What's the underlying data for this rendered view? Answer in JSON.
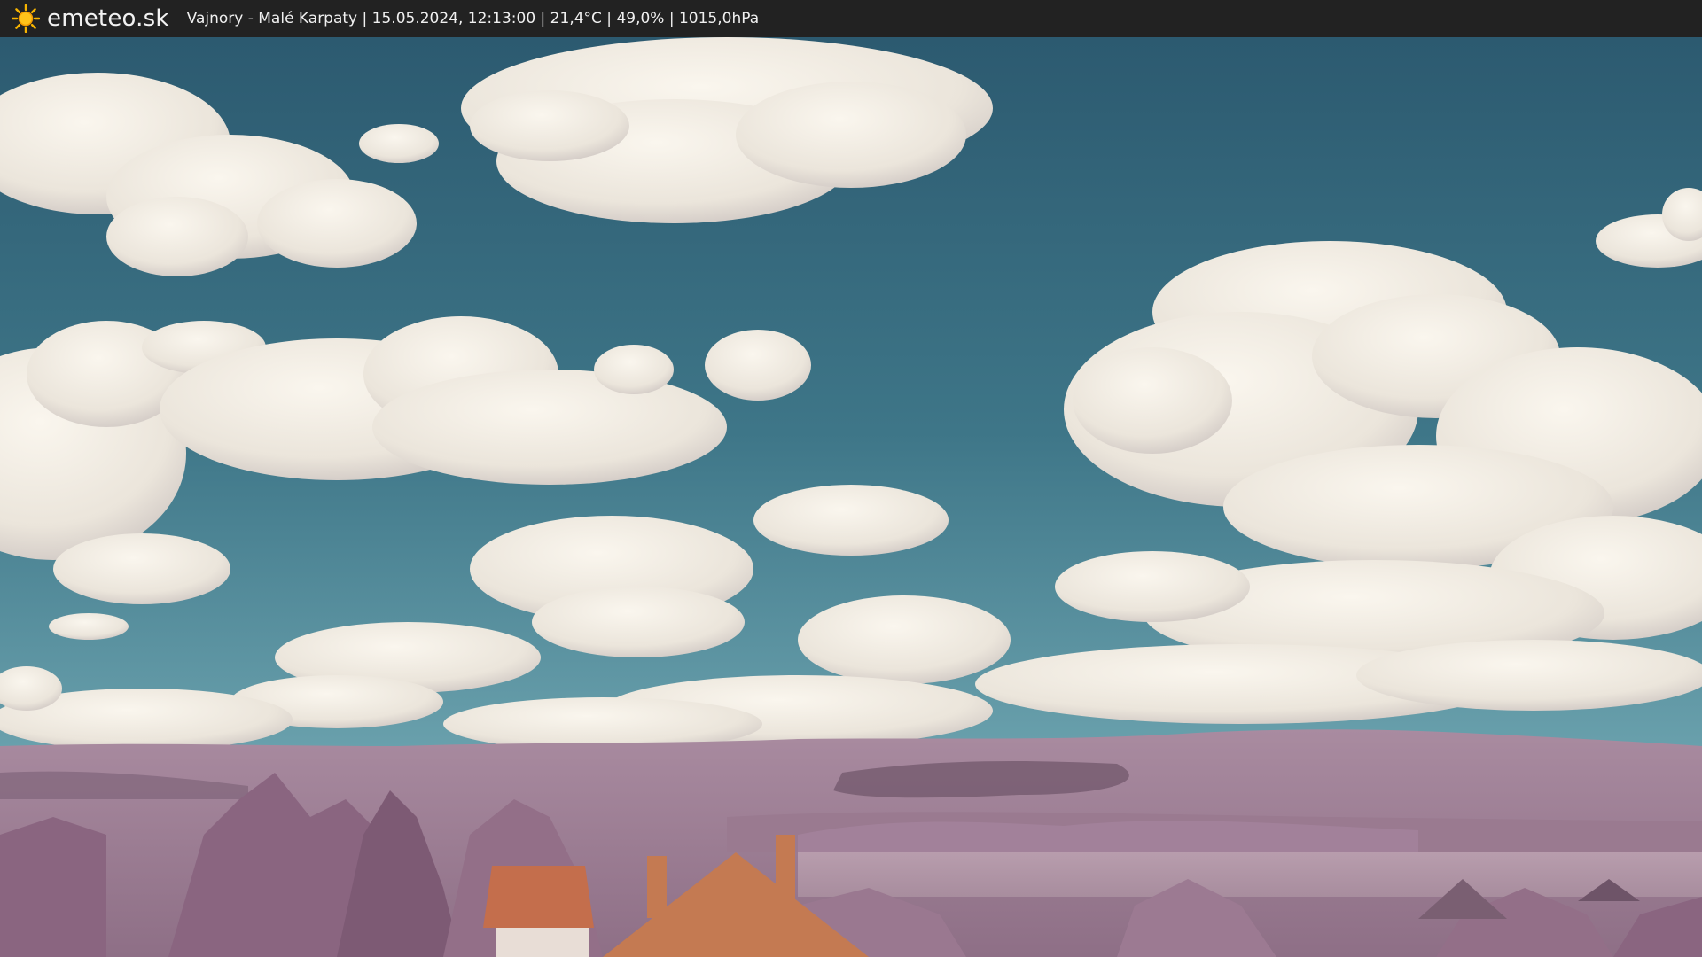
{
  "header": {
    "logo_icon": "sun-icon",
    "brand": "emeteo.sk",
    "caption": "Vajnory - Malé Karpaty | 15.05.2024, 12:13:00 | 21,4°C | 49,0% | 1015,0hPa"
  },
  "colors": {
    "bar": "#222222",
    "sky_top": "#2f5f73",
    "sky_bottom": "#5f9aa8",
    "cloud": "#f1ece4",
    "hills": "#9c7d92",
    "foliage": "#8f6a86",
    "roof": "#c47a52"
  }
}
